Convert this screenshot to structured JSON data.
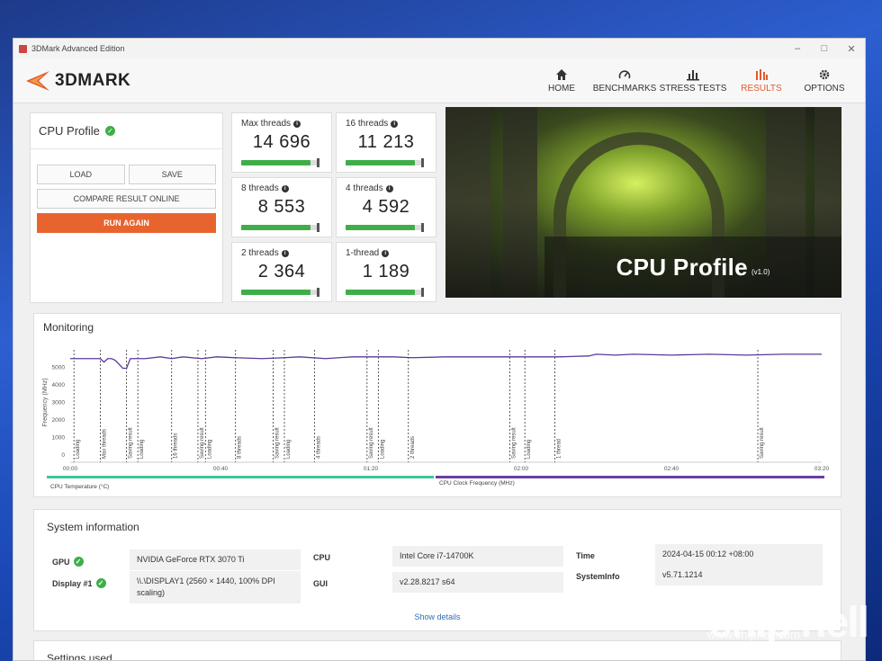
{
  "window": {
    "title": "3DMark Advanced Edition"
  },
  "brand": {
    "logo_text": "3DMARK",
    "accent": "#e3592d"
  },
  "nav": [
    {
      "label": "HOME",
      "icon": "home-icon",
      "active": false
    },
    {
      "label": "BENCHMARKS",
      "icon": "gauge-icon",
      "active": false
    },
    {
      "label": "STRESS TESTS",
      "icon": "bars-icon",
      "active": false
    },
    {
      "label": "RESULTS",
      "icon": "results-icon",
      "active": true
    },
    {
      "label": "OPTIONS",
      "icon": "gear-icon",
      "active": false
    }
  ],
  "profile": {
    "title": "CPU Profile",
    "load": "LOAD",
    "save": "SAVE",
    "compare": "COMPARE RESULT ONLINE",
    "run_again": "RUN AGAIN"
  },
  "scores": [
    {
      "label": "Max threads",
      "value": "14 696",
      "fill": 0.92
    },
    {
      "label": "16 threads",
      "value": "11 213",
      "fill": 0.92
    },
    {
      "label": "8 threads",
      "value": "8 553",
      "fill": 0.92
    },
    {
      "label": "4 threads",
      "value": "4 592",
      "fill": 0.92
    },
    {
      "label": "2 threads",
      "value": "2 364",
      "fill": 0.92
    },
    {
      "label": "1-thread",
      "value": "1 189",
      "fill": 0.92
    }
  ],
  "hero": {
    "title": "CPU Profile",
    "version": "(v1.0)"
  },
  "monitoring": {
    "title": "Monitoring",
    "legend": [
      "CPU Temperature (°C)",
      "CPU Clock Frequency (MHz)"
    ],
    "legend_colors": [
      "#3cc79b",
      "#6b3fa0"
    ]
  },
  "chart_data": {
    "type": "line",
    "ylabel": "Frequency (MHz)",
    "ylim": [
      0,
      6000
    ],
    "yticks": [
      0,
      1000,
      2000,
      3000,
      4000,
      5000
    ],
    "xticks": [
      "00:00",
      "00:40",
      "01:20",
      "02:00",
      "02:40",
      "03:20"
    ],
    "xlim_seconds": [
      0,
      200
    ],
    "series": [
      {
        "name": "CPU Clock Frequency (MHz)",
        "x": [
          0,
          8,
          9,
          10,
          11,
          12,
          14,
          15,
          16,
          18,
          20,
          24,
          27,
          30,
          35,
          39,
          44,
          51,
          57,
          61,
          68,
          75,
          82,
          86,
          91,
          100,
          110,
          115,
          121,
          130,
          138,
          140,
          145,
          150,
          160,
          170,
          180,
          190,
          200
        ],
        "y": [
          5500,
          5500,
          5300,
          5500,
          5500,
          5400,
          4950,
          4950,
          5500,
          5500,
          5500,
          5600,
          5500,
          5600,
          5500,
          5600,
          5550,
          5500,
          5550,
          5600,
          5500,
          5600,
          5600,
          5600,
          5550,
          5600,
          5600,
          5600,
          5600,
          5600,
          5650,
          5750,
          5700,
          5750,
          5700,
          5750,
          5700,
          5750,
          5750
        ]
      }
    ],
    "markers": [
      {
        "t": 1,
        "label": "Loading"
      },
      {
        "t": 8,
        "label": "Max threads"
      },
      {
        "t": 15,
        "label": "Saving result"
      },
      {
        "t": 18,
        "label": "Loading"
      },
      {
        "t": 27,
        "label": "16 threads"
      },
      {
        "t": 34,
        "label": "Saving result"
      },
      {
        "t": 36,
        "label": "Loading"
      },
      {
        "t": 44,
        "label": "8 threads"
      },
      {
        "t": 54,
        "label": "Saving result"
      },
      {
        "t": 57,
        "label": "Loading"
      },
      {
        "t": 65,
        "label": "4 threads"
      },
      {
        "t": 79,
        "label": "Saving result"
      },
      {
        "t": 82,
        "label": "Loading"
      },
      {
        "t": 90,
        "label": "2 threads"
      },
      {
        "t": 117,
        "label": "Saving result"
      },
      {
        "t": 121,
        "label": "Loading"
      },
      {
        "t": 129,
        "label": "1 thread"
      },
      {
        "t": 183,
        "label": "Saving result"
      }
    ]
  },
  "system_info": {
    "title": "System information",
    "rows": [
      {
        "key": "GPU",
        "value": "NVIDIA GeForce RTX 3070 Ti",
        "check": true
      },
      {
        "key": "Display #1",
        "value": "\\\\.\\DISPLAY1 (2560 × 1440, 100% DPI scaling)",
        "check": true
      },
      {
        "key": "CPU",
        "value": "Intel Core i7-14700K",
        "check": false
      },
      {
        "key": "GUI",
        "value": "v2.28.8217 s64",
        "check": false
      },
      {
        "key": "Time",
        "value": "2024-04-15 00:12 +08:00",
        "check": false
      },
      {
        "key": "SystemInfo",
        "value": "v5.71.1214",
        "check": false
      }
    ],
    "show_details": "Show details"
  },
  "settings": {
    "title": "Settings used"
  },
  "watermark": {
    "big": "chip hell",
    "url": "www.chiphell.com"
  }
}
